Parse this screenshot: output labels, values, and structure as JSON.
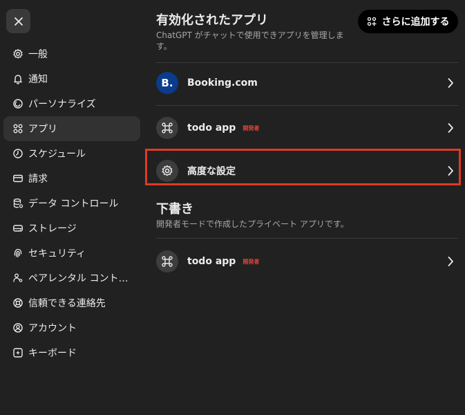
{
  "close_icon": "close-icon",
  "sidebar": {
    "items": [
      {
        "label": "一般",
        "icon": "gear-icon"
      },
      {
        "label": "通知",
        "icon": "bell-icon"
      },
      {
        "label": "パーソナライズ",
        "icon": "personalize-icon"
      },
      {
        "label": "アプリ",
        "icon": "apps-icon",
        "active": true
      },
      {
        "label": "スケジュール",
        "icon": "clock-icon"
      },
      {
        "label": "請求",
        "icon": "card-icon"
      },
      {
        "label": "データ コントロール",
        "icon": "database-icon"
      },
      {
        "label": "ストレージ",
        "icon": "storage-icon"
      },
      {
        "label": "セキュリティ",
        "icon": "fingerprint-icon"
      },
      {
        "label": "ペアレンタル コント…",
        "icon": "parental-icon"
      },
      {
        "label": "信頼できる連絡先",
        "icon": "lifebuoy-icon"
      },
      {
        "label": "アカウント",
        "icon": "account-icon"
      },
      {
        "label": "キーボード",
        "icon": "keyboard-icon"
      }
    ]
  },
  "enabled": {
    "title": "有効化されたアプリ",
    "description": "ChatGPT がチャットで使用できアプリを管理します。",
    "add_button": "さらに追加する",
    "apps": [
      {
        "name": "Booking.com",
        "avatar_text": "B.",
        "badge": ""
      },
      {
        "name": "todo app",
        "badge": "開発者"
      }
    ],
    "advanced": "高度な設定"
  },
  "drafts": {
    "title": "下書き",
    "description": "開発者モードで作成したプライベート アプリです。",
    "apps": [
      {
        "name": "todo app",
        "badge": "開発者"
      }
    ]
  },
  "colors": {
    "background": "#212121",
    "highlight": "#e03a23",
    "booking_brand": "#0a3b8c",
    "badge_red": "#e2453a"
  }
}
